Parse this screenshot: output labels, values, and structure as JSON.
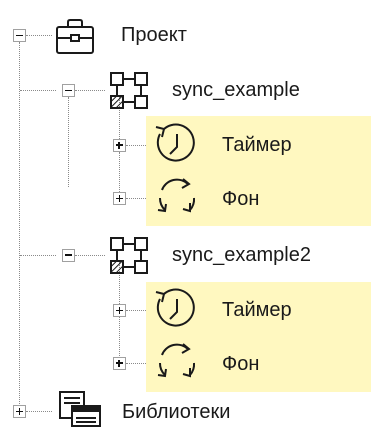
{
  "tree": {
    "project": {
      "label": "Проект",
      "icon": "briefcase-icon",
      "expanded": true
    },
    "programs": [
      {
        "label": "sync_example",
        "icon": "program-blocks-icon",
        "expanded": true,
        "tasks": [
          {
            "label": "Таймер",
            "icon": "timer-icon",
            "expanded": false
          },
          {
            "label": "Фон",
            "icon": "cycle-icon",
            "expanded": false
          }
        ]
      },
      {
        "label": "sync_example2",
        "icon": "program-blocks-icon",
        "expanded": true,
        "tasks": [
          {
            "label": "Таймер",
            "icon": "timer-icon",
            "expanded": false
          },
          {
            "label": "Фон",
            "icon": "cycle-icon",
            "expanded": false
          }
        ]
      }
    ],
    "libraries": {
      "label": "Библиотеки",
      "icon": "libraries-icon",
      "expanded": false
    }
  },
  "colors": {
    "highlight": "#fff8c0",
    "icon_stroke": "#1a1a1a",
    "connector": "#8a8a8a"
  }
}
